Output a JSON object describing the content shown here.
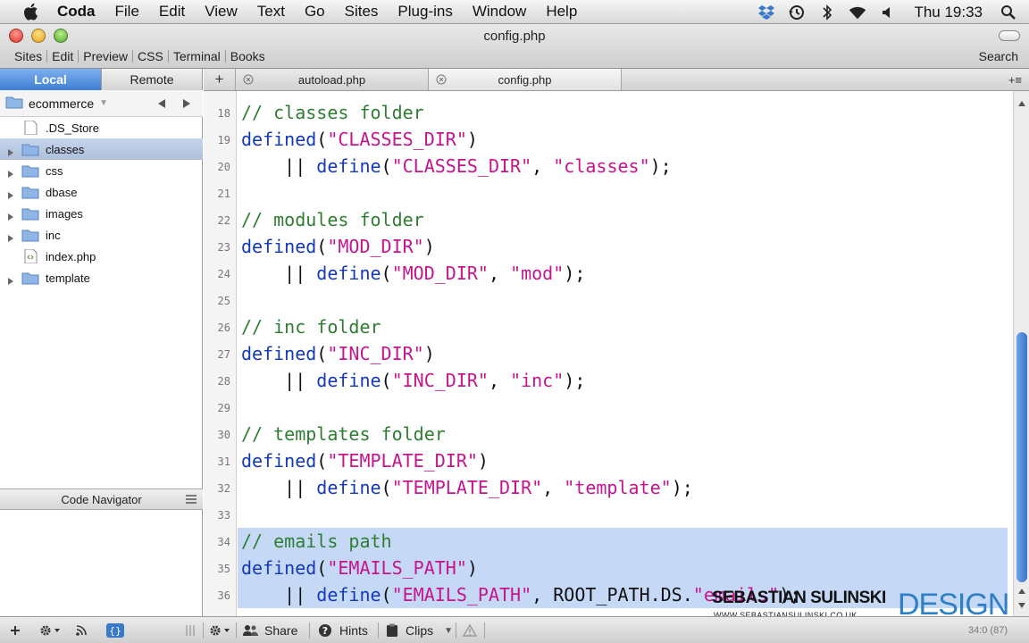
{
  "menubar": {
    "app_name": "Coda",
    "items": [
      "File",
      "Edit",
      "View",
      "Text",
      "Go",
      "Sites",
      "Plug-ins",
      "Window",
      "Help"
    ],
    "clock": "Thu 19:33",
    "status_icons": [
      "dropbox-icon",
      "time-machine-icon",
      "bluetooth-icon",
      "wifi-icon",
      "volume-icon",
      "spotlight-icon"
    ]
  },
  "window": {
    "title": "config.php",
    "toolbar_tabs": [
      "Sites",
      "Edit",
      "Preview",
      "CSS",
      "Terminal",
      "Books"
    ],
    "search_label": "Search"
  },
  "sidebar": {
    "tabs": {
      "local": "Local",
      "remote": "Remote"
    },
    "project": "ecommerce",
    "files": [
      {
        "name": ".DS_Store",
        "type": "file",
        "expandable": false,
        "selected": false
      },
      {
        "name": "classes",
        "type": "folder",
        "expandable": true,
        "selected": true
      },
      {
        "name": "css",
        "type": "folder",
        "expandable": true,
        "selected": false
      },
      {
        "name": "dbase",
        "type": "folder",
        "expandable": true,
        "selected": false
      },
      {
        "name": "images",
        "type": "folder",
        "expandable": true,
        "selected": false
      },
      {
        "name": "inc",
        "type": "folder",
        "expandable": true,
        "selected": false
      },
      {
        "name": "index.php",
        "type": "php",
        "expandable": false,
        "selected": false
      },
      {
        "name": "template",
        "type": "folder",
        "expandable": true,
        "selected": false
      }
    ],
    "navigator_title": "Code Navigator"
  },
  "editor": {
    "tabs": [
      {
        "label": "autoload.php",
        "active": false
      },
      {
        "label": "config.php",
        "active": true
      }
    ],
    "selected_lines": [
      34,
      35,
      36
    ],
    "lines": [
      {
        "num": "18",
        "tokens": [
          {
            "t": "// classes folder",
            "c": "comment"
          }
        ]
      },
      {
        "num": "19",
        "tokens": [
          {
            "t": "defined",
            "c": "fn"
          },
          {
            "t": "(",
            "c": "plain"
          },
          {
            "t": "\"CLASSES_DIR\"",
            "c": "str"
          },
          {
            "t": ")",
            "c": "plain"
          }
        ]
      },
      {
        "num": "20",
        "tokens": [
          {
            "t": "    || ",
            "c": "plain"
          },
          {
            "t": "define",
            "c": "fn"
          },
          {
            "t": "(",
            "c": "plain"
          },
          {
            "t": "\"CLASSES_DIR\"",
            "c": "str"
          },
          {
            "t": ", ",
            "c": "plain"
          },
          {
            "t": "\"classes\"",
            "c": "str"
          },
          {
            "t": ");",
            "c": "plain"
          }
        ]
      },
      {
        "num": "21",
        "tokens": []
      },
      {
        "num": "22",
        "tokens": [
          {
            "t": "// modules folder",
            "c": "comment"
          }
        ]
      },
      {
        "num": "23",
        "tokens": [
          {
            "t": "defined",
            "c": "fn"
          },
          {
            "t": "(",
            "c": "plain"
          },
          {
            "t": "\"MOD_DIR\"",
            "c": "str"
          },
          {
            "t": ")",
            "c": "plain"
          }
        ]
      },
      {
        "num": "24",
        "tokens": [
          {
            "t": "    || ",
            "c": "plain"
          },
          {
            "t": "define",
            "c": "fn"
          },
          {
            "t": "(",
            "c": "plain"
          },
          {
            "t": "\"MOD_DIR\"",
            "c": "str"
          },
          {
            "t": ", ",
            "c": "plain"
          },
          {
            "t": "\"mod\"",
            "c": "str"
          },
          {
            "t": ");",
            "c": "plain"
          }
        ]
      },
      {
        "num": "25",
        "tokens": []
      },
      {
        "num": "26",
        "tokens": [
          {
            "t": "// inc folder",
            "c": "comment"
          }
        ]
      },
      {
        "num": "27",
        "tokens": [
          {
            "t": "defined",
            "c": "fn"
          },
          {
            "t": "(",
            "c": "plain"
          },
          {
            "t": "\"INC_DIR\"",
            "c": "str"
          },
          {
            "t": ")",
            "c": "plain"
          }
        ]
      },
      {
        "num": "28",
        "tokens": [
          {
            "t": "    || ",
            "c": "plain"
          },
          {
            "t": "define",
            "c": "fn"
          },
          {
            "t": "(",
            "c": "plain"
          },
          {
            "t": "\"INC_DIR\"",
            "c": "str"
          },
          {
            "t": ", ",
            "c": "plain"
          },
          {
            "t": "\"inc\"",
            "c": "str"
          },
          {
            "t": ");",
            "c": "plain"
          }
        ]
      },
      {
        "num": "29",
        "tokens": []
      },
      {
        "num": "30",
        "tokens": [
          {
            "t": "// templates folder",
            "c": "comment"
          }
        ]
      },
      {
        "num": "31",
        "tokens": [
          {
            "t": "defined",
            "c": "fn"
          },
          {
            "t": "(",
            "c": "plain"
          },
          {
            "t": "\"TEMPLATE_DIR\"",
            "c": "str"
          },
          {
            "t": ")",
            "c": "plain"
          }
        ]
      },
      {
        "num": "32",
        "tokens": [
          {
            "t": "    || ",
            "c": "plain"
          },
          {
            "t": "define",
            "c": "fn"
          },
          {
            "t": "(",
            "c": "plain"
          },
          {
            "t": "\"TEMPLATE_DIR\"",
            "c": "str"
          },
          {
            "t": ", ",
            "c": "plain"
          },
          {
            "t": "\"template\"",
            "c": "str"
          },
          {
            "t": ");",
            "c": "plain"
          }
        ]
      },
      {
        "num": "33",
        "tokens": []
      },
      {
        "num": "34",
        "tokens": [
          {
            "t": "// emails path",
            "c": "comment"
          }
        ]
      },
      {
        "num": "35",
        "tokens": [
          {
            "t": "defined",
            "c": "fn"
          },
          {
            "t": "(",
            "c": "plain"
          },
          {
            "t": "\"EMAILS_PATH\"",
            "c": "str"
          },
          {
            "t": ")",
            "c": "plain"
          }
        ]
      },
      {
        "num": "36",
        "tokens": [
          {
            "t": "    || ",
            "c": "plain"
          },
          {
            "t": "define",
            "c": "fn"
          },
          {
            "t": "(",
            "c": "plain"
          },
          {
            "t": "\"EMAILS_PATH\"",
            "c": "str"
          },
          {
            "t": ", ",
            "c": "plain"
          },
          {
            "t": "ROOT_PATH.DS.",
            "c": "plain"
          },
          {
            "t": "\"emails\"",
            "c": "str"
          },
          {
            "t": ");",
            "c": "plain"
          }
        ]
      }
    ]
  },
  "watermark": {
    "name": "SEBASTIAN SULINSKI",
    "url": "WWW.SEBASTIANSULINSKI.CO.UK",
    "design": "DESIGN"
  },
  "bottombar": {
    "share": "Share",
    "hints": "Hints",
    "clips": "Clips",
    "cursor": "34:0 (87)"
  },
  "colors": {
    "comment": "#2f7d32",
    "function": "#1438b8",
    "string": "#c5148e",
    "selection": "#c5d9f7",
    "accent": "#3f7fd3"
  }
}
